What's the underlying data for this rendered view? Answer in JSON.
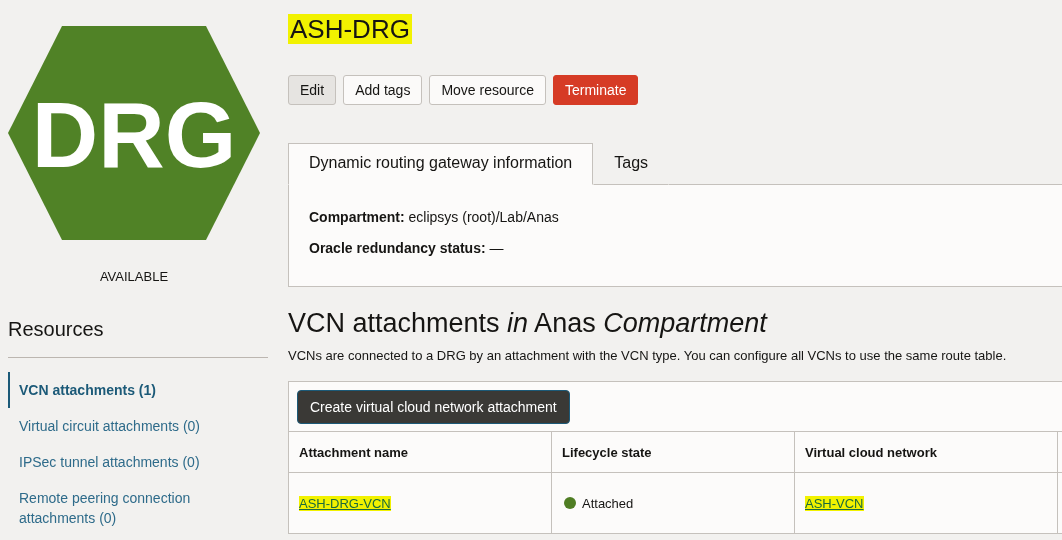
{
  "logo": {
    "text": "DRG",
    "color": "#508226"
  },
  "status": "AVAILABLE",
  "resources": {
    "title": "Resources",
    "items": [
      {
        "label": "VCN attachments (1)",
        "selected": true
      },
      {
        "label": "Virtual circuit attachments (0)",
        "selected": false
      },
      {
        "label": "IPSec tunnel attachments (0)",
        "selected": false
      },
      {
        "label": "Remote peering connection attachments (0)",
        "selected": false
      }
    ]
  },
  "title": {
    "text": "ASH-DRG",
    "highlighted": true
  },
  "actions": [
    {
      "label": "Edit",
      "kind": "pressed"
    },
    {
      "label": "Add tags",
      "kind": "default"
    },
    {
      "label": "Move resource",
      "kind": "default"
    },
    {
      "label": "Terminate",
      "kind": "danger"
    }
  ],
  "tabs": [
    {
      "label": "Dynamic routing gateway information",
      "selected": true
    },
    {
      "label": "Tags",
      "selected": false
    }
  ],
  "details": [
    {
      "label": "Compartment:",
      "value": "eclipsys (root)/Lab/Anas"
    },
    {
      "label": "Oracle redundancy status:",
      "value": "—"
    }
  ],
  "section": {
    "title": "VCN attachments *in* Anas *Compartment*",
    "description": "VCNs are connected to a DRG by an attachment with the VCN type. You can configure all VCNs to use the same route table.",
    "create_button": "Create virtual cloud network attachment"
  },
  "table": {
    "columns": [
      "Attachment name",
      "Lifecycle state",
      "Virtual cloud network"
    ],
    "rows": [
      {
        "attachment_name": {
          "text": "ASH-DRG-VCN",
          "highlighted": true
        },
        "state": {
          "text": "Attached",
          "color": "#4f7d23"
        },
        "vcn": {
          "text": "ASH-VCN",
          "highlighted": true
        }
      }
    ]
  }
}
